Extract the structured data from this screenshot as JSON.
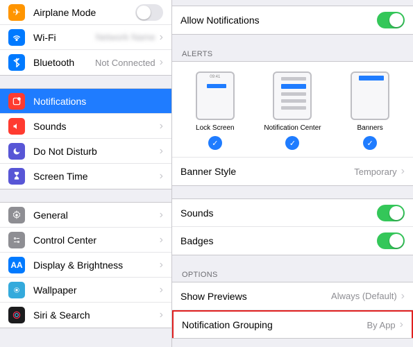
{
  "sidebar": {
    "g1": [
      {
        "label": "Airplane Mode",
        "toggle": false
      },
      {
        "label": "Wi-Fi",
        "detail": ""
      },
      {
        "label": "Bluetooth",
        "detail": "Not Connected"
      }
    ],
    "g2": [
      {
        "label": "Notifications"
      },
      {
        "label": "Sounds"
      },
      {
        "label": "Do Not Disturb"
      },
      {
        "label": "Screen Time"
      }
    ],
    "g3": [
      {
        "label": "General"
      },
      {
        "label": "Control Center"
      },
      {
        "label": "Display & Brightness"
      },
      {
        "label": "Wallpaper"
      },
      {
        "label": "Siri & Search"
      }
    ]
  },
  "main": {
    "allow": "Allow Notifications",
    "alerts_header": "ALERTS",
    "alerts": {
      "lock": "Lock Screen",
      "center": "Notification Center",
      "banners": "Banners",
      "time": "09:41"
    },
    "banner_style": {
      "label": "Banner Style",
      "value": "Temporary"
    },
    "sounds": "Sounds",
    "badges": "Badges",
    "options_header": "OPTIONS",
    "previews": {
      "label": "Show Previews",
      "value": "Always (Default)"
    },
    "grouping": {
      "label": "Notification Grouping",
      "value": "By App"
    }
  }
}
